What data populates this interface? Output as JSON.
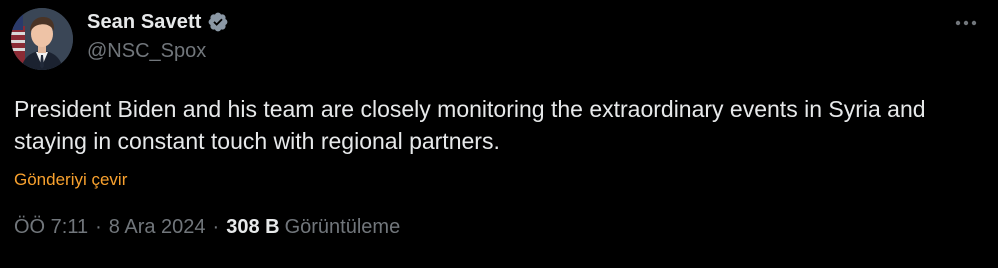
{
  "author": {
    "display_name": "Sean Savett",
    "handle": "@NSC_Spox",
    "verified": true,
    "verified_color": "#8b98a5"
  },
  "icons": {
    "more": "more-horizontal-icon",
    "verified": "verified-badge-icon"
  },
  "tweet": {
    "text": "President Biden and his team are closely monitoring the extraordinary events in Syria and staying in constant touch with regional partners.",
    "translate_label": "Gönderiyi çevir",
    "time": "ÖÖ 7:11",
    "separator": "·",
    "date": "8 Ara 2024",
    "views_count": "308 B",
    "views_label": "Görüntüleme"
  },
  "colors": {
    "background": "#000000",
    "text_primary": "#e7e9ea",
    "text_secondary": "#71767b",
    "translate_link": "#f8a12e"
  }
}
